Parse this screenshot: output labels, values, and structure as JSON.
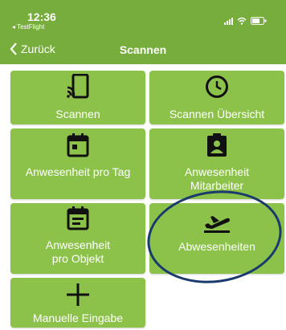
{
  "statusbar": {
    "time": "12:36",
    "back_app": "◂ TestFlight"
  },
  "nav": {
    "back_label": "Zurück",
    "title": "Scannen"
  },
  "tiles": [
    {
      "label": "Scannen",
      "icon": "phone-nfc-icon"
    },
    {
      "label": "Scannen Übersicht",
      "icon": "clock-icon"
    },
    {
      "label": "Anwesenheit pro Tag",
      "icon": "calendar-day-icon"
    },
    {
      "label": "Anwesenheit\nMitarbeiter",
      "icon": "badge-person-icon"
    },
    {
      "label": "Anwesenheit\npro Objekt",
      "icon": "calendar-list-icon"
    },
    {
      "label": "Abwesenheiten",
      "icon": "flight-takeoff-icon"
    },
    {
      "label": "Manuelle Eingabe",
      "icon": "plus-icon"
    }
  ],
  "colors": {
    "header": "#77ad3c",
    "tile": "#8dc24a",
    "annotation": "#1a3a6e"
  }
}
